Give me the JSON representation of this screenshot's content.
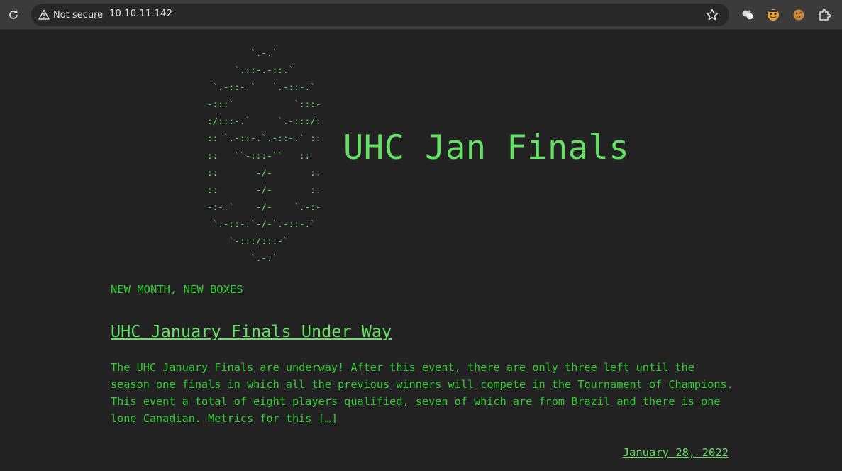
{
  "browser": {
    "security_label": "Not secure",
    "url": "10.10.11.142",
    "icons": [
      "reload-icon",
      "warning-icon",
      "bookmark-star-icon",
      "extension-bubbles-icon",
      "extension-face-icon",
      "extension-cookie-icon",
      "extensions-puzzle-icon"
    ]
  },
  "site": {
    "ascii_logo": "        `.-.`\n     `.::-.-::.`\n `.-::-.`   `.-::-.`\n-:::`           `:::-\n:/:::-.`     `.-:::/:\n:: `.-::-.`.-::-.` ::\n::   ``-:::-``   ::\n::       -/-       ::\n::       -/-       ::\n-:-.`    -/-    `.-:-\n `.-::-.`-/-`.-::-.`\n    `-:::/:::-`\n        `.-.`",
    "title": "UHC Jan Finals",
    "tagline": "NEW MONTH, NEW BOXES"
  },
  "post": {
    "title": "UHC January Finals Under Way",
    "excerpt": "The UHC January Finals are underway! After this event, there are only three left until the season one finals in which all the previous winners will compete in the Tournament of Champions. This event a total of eight players qualified, seven of which are from Brazil and there is one lone Canadian. Metrics for this […]",
    "date": "January 28, 2022"
  },
  "colors": {
    "background": "#222222",
    "text_green": "#32cd32",
    "light_green": "#66e066",
    "chrome_bg": "#3b3b3b"
  }
}
